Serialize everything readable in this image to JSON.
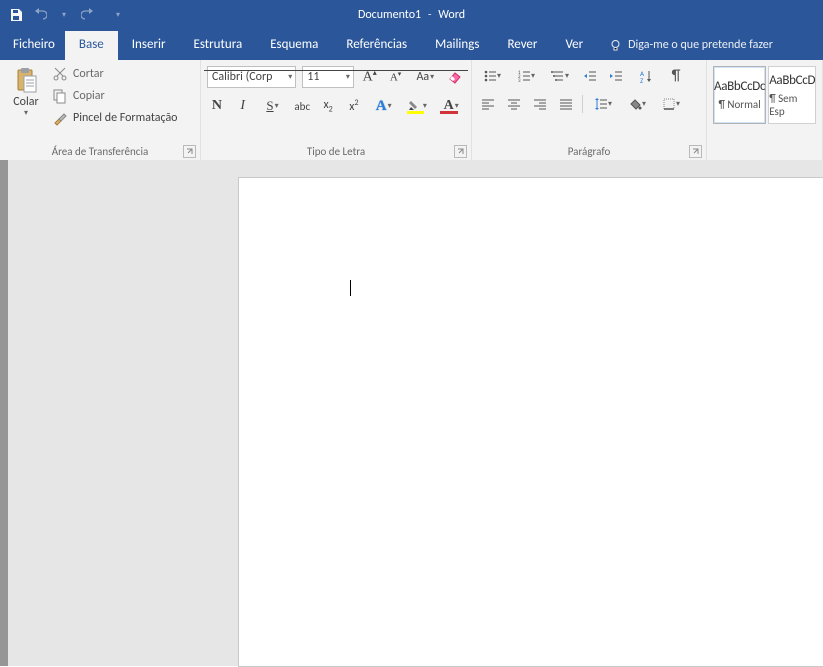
{
  "title": {
    "doc": "Documento1",
    "app": "Word",
    "sep": "-"
  },
  "tabs": {
    "file": "Ficheiro",
    "home": "Base",
    "insert": "Inserir",
    "layout": "Estrutura",
    "design": "Esquema",
    "references": "Referências",
    "mailings": "Mailings",
    "review": "Rever",
    "view": "Ver",
    "tellme": "Diga-me o que pretende fazer"
  },
  "clipboard": {
    "paste": "Colar",
    "cut": "Cortar",
    "copy": "Copiar",
    "painter": "Pincel de Formatação",
    "group": "Área de Transferência"
  },
  "font": {
    "family": "Calibri (Corp",
    "size": "11",
    "group": "Tipo de Letra"
  },
  "paragraph": {
    "group": "Parágrafo"
  },
  "styles": {
    "preview": "AaBbCcDc",
    "preview2": "AaBbCcD",
    "normal": "¶ Normal",
    "nospace": "¶ Sem Esp"
  }
}
